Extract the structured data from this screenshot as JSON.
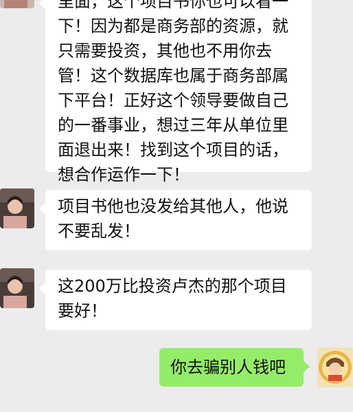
{
  "messages": [
    {
      "sender": "contact",
      "lines": [
        "里面，这个项目书你也可以看一",
        "下！因为都是商务部的资源，就",
        "只需要投资，其他也不用你去",
        "管！这个数据库也属于商务部属",
        "下平台！正好这个领导要做自己",
        "的一番事业，想过三年从单位里",
        "面退出来！找到这个项目的话，",
        "想合作运作一下！"
      ]
    },
    {
      "sender": "contact",
      "lines": [
        "项目书他也没发给其他人，他说",
        "不要乱发！"
      ]
    },
    {
      "sender": "contact",
      "lines": [
        "这200万比投资卢杰的那个项目",
        "要好！"
      ]
    },
    {
      "sender": "me",
      "lines": [
        "你去骗别人钱吧"
      ]
    }
  ],
  "colors": {
    "background": "#ececec",
    "incoming_bubble": "#ffffff",
    "outgoing_bubble": "#95ec69",
    "text": "#111111"
  }
}
